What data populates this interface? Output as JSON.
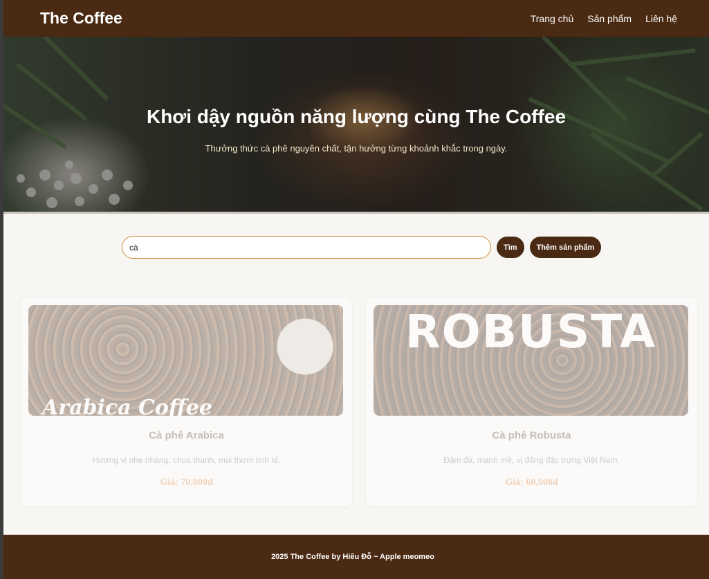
{
  "header": {
    "brand": "The Coffee",
    "nav": [
      "Trang chủ",
      "Sản phẩm",
      "Liên hệ"
    ]
  },
  "hero": {
    "title": "Khơi dậy nguồn năng lượng cùng The Coffee",
    "subtitle": "Thưởng thức cà phê nguyên chất, tận hưởng từng khoảnh khắc trong ngày."
  },
  "search": {
    "value": "cà",
    "search_label": "Tìm",
    "add_label": "Thêm sản phẩm"
  },
  "products": [
    {
      "name": "Cà phê Arabica",
      "description": "Hương vị nhẹ nhàng, chua thanh, mùi thơm tinh tế.",
      "price": "Giá: 70,000đ",
      "image_text": "Arabica Coffee"
    },
    {
      "name": "Cà phê Robusta",
      "description": "Đậm đà, mạnh mẽ, vị đắng đặc trưng Việt Nam.",
      "price": "Giá: 60,000đ",
      "image_text": "ROBUSTA"
    }
  ],
  "footer": {
    "text": "2025 The Coffee by Hiếu Đỗ ~ Apple meomeo"
  },
  "colors": {
    "brand_brown": "#4a2a12",
    "price_orange": "#d76a1e",
    "input_border": "#d48a3a"
  }
}
